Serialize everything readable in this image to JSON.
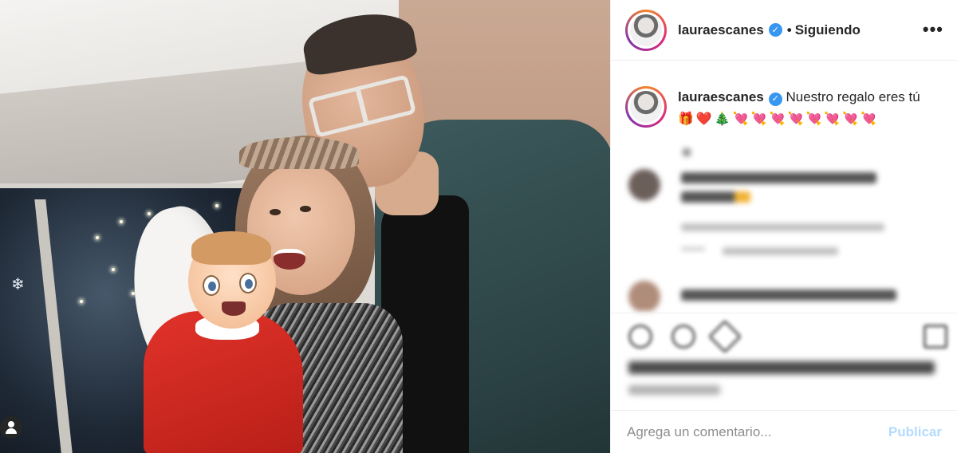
{
  "post": {
    "photo_alt": "Selfie photo",
    "tagged_icon": "user-tag-icon"
  },
  "header": {
    "username": "lauraescanes",
    "verified_icon": "verified-badge-icon",
    "separator": "•",
    "follow_status": "Siguiendo",
    "more_icon_text": "•••"
  },
  "caption": {
    "username": "lauraescanes",
    "text": "Nuestro regalo eres tú",
    "emojis": "🎁❤️🎄💘💘💘💘💘💘💘💘"
  },
  "comment_box": {
    "placeholder": "Agrega un comentario...",
    "post_label": "Publicar"
  },
  "colors": {
    "verified": "#3897f0",
    "post_button_disabled": "#b3dbff",
    "text": "#262626",
    "placeholder": "#8e8e8e"
  }
}
